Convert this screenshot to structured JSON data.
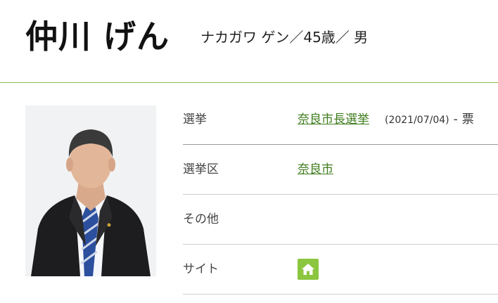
{
  "candidate": {
    "name": "仲川 げん",
    "meta": "ナカガワ ゲン／45歳／ 男"
  },
  "details": {
    "election": {
      "label": "選挙",
      "link": "奈良市長選挙",
      "date": "(2021/07/04)",
      "dash": "-",
      "votes": "票"
    },
    "district": {
      "label": "選挙区",
      "link": "奈良市"
    },
    "other": {
      "label": "その他"
    },
    "site": {
      "label": "サイト",
      "icon": "home-icon"
    }
  },
  "colors": {
    "accent": "#8cc63f",
    "link": "#3f7d1e",
    "divider": "#8cbf4a"
  }
}
